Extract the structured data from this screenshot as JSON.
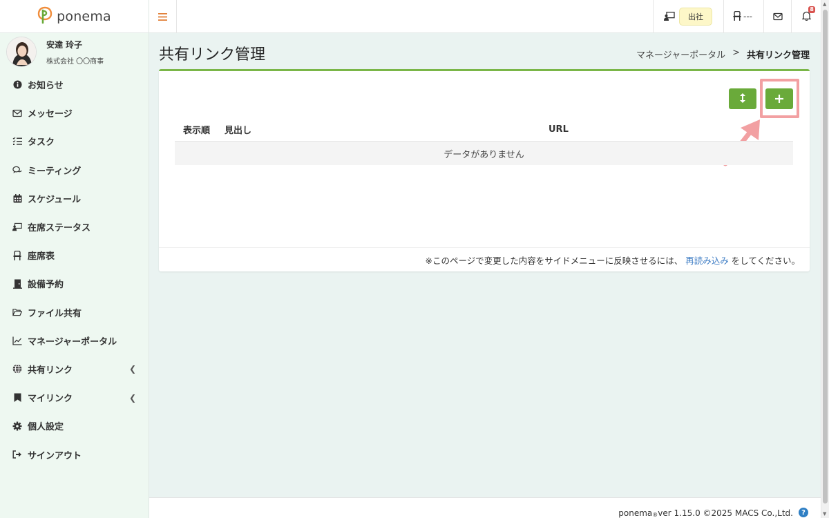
{
  "brand": {
    "name": "ponema",
    "accent": "#6aaa3a"
  },
  "user": {
    "name": "安達 玲子",
    "company": "株式会社 〇〇商事"
  },
  "nav": [
    {
      "label": "お知らせ",
      "icon": "info-circle-icon",
      "chevron": false
    },
    {
      "label": "メッセージ",
      "icon": "envelope-icon",
      "chevron": false
    },
    {
      "label": "タスク",
      "icon": "list-check-icon",
      "chevron": false
    },
    {
      "label": "ミーティング",
      "icon": "chat-bubbles-icon",
      "chevron": false
    },
    {
      "label": "スケジュール",
      "icon": "calendar-icon",
      "chevron": false
    },
    {
      "label": "在席ステータス",
      "icon": "presence-board-icon",
      "chevron": false
    },
    {
      "label": "座席表",
      "icon": "chair-icon",
      "chevron": false
    },
    {
      "label": "設備予約",
      "icon": "door-icon",
      "chevron": false
    },
    {
      "label": "ファイル共有",
      "icon": "folder-open-icon",
      "chevron": false
    },
    {
      "label": "マネージャーポータル",
      "icon": "chart-line-icon",
      "chevron": false
    },
    {
      "label": "共有リンク",
      "icon": "globe-icon",
      "chevron": true
    },
    {
      "label": "マイリンク",
      "icon": "bookmark-icon",
      "chevron": true
    },
    {
      "label": "個人設定",
      "icon": "gear-icon",
      "chevron": false
    },
    {
      "label": "サインアウト",
      "icon": "sign-out-icon",
      "chevron": false
    }
  ],
  "topbar": {
    "status_label": "出社",
    "seat_label": "---",
    "notification_count": "8"
  },
  "page": {
    "title": "共有リンク管理",
    "breadcrumb": {
      "parent": "マネージャーポータル",
      "separator": ">",
      "current": "共有リンク管理"
    }
  },
  "table": {
    "columns": [
      "表示順",
      "見出し",
      "URL"
    ],
    "empty_text": "データがありません"
  },
  "card_footer": {
    "before": "※このページで変更した内容をサイドメニューに反映させるには、",
    "link": "再読み込み",
    "after": "をしてください。"
  },
  "footer": {
    "brand": "ponema",
    "mark": "®",
    "version": " ver 1.15.0 ©2025 MACS Co.,Ltd.",
    "help": "?"
  }
}
